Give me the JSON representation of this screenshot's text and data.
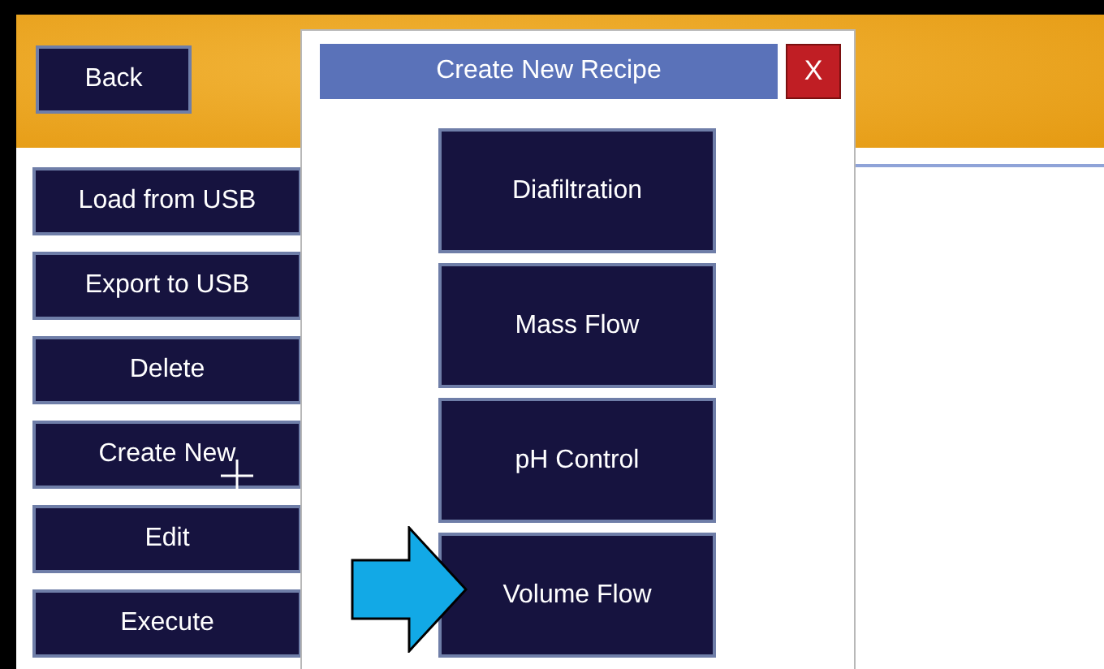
{
  "header": {
    "back_button": "Back"
  },
  "sidebar": {
    "buttons": [
      "Load from USB",
      "Export to USB",
      "Delete",
      "Create New",
      "Edit",
      "Execute"
    ]
  },
  "dialog": {
    "title": "Create New Recipe",
    "close": "X",
    "options": [
      "Diafiltration",
      "Mass Flow",
      "pH Control",
      "Volume Flow"
    ]
  }
}
